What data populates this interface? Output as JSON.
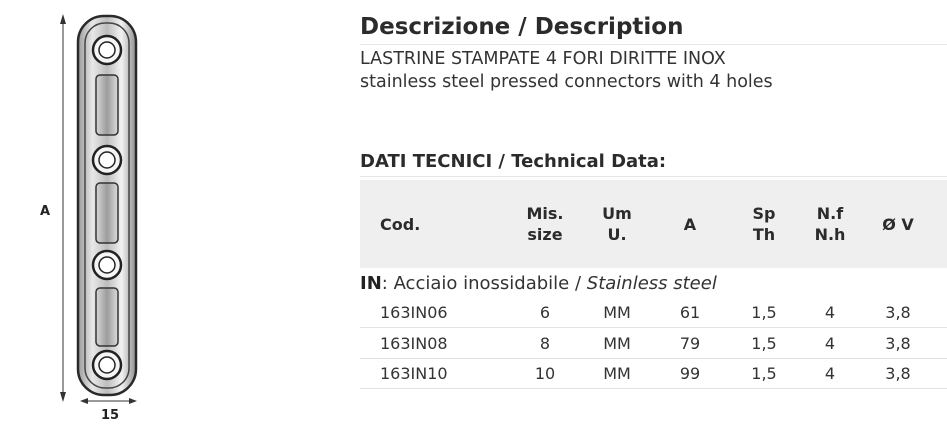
{
  "product_drawing": {
    "dim_a_label": "A",
    "dim_width_label": "15"
  },
  "description": {
    "title": "Descrizione / Description",
    "line_it": "LASTRINE STAMPATE 4 FORI DIRITTE INOX",
    "line_en": "stainless steel pressed connectors with 4 holes"
  },
  "technical": {
    "title": "DATI TECNICI / Technical Data:",
    "headers": [
      {
        "line1": "Cod.",
        "line2": ""
      },
      {
        "line1": "Mis.",
        "line2": "size"
      },
      {
        "line1": "Um",
        "line2": "U."
      },
      {
        "line1": "A",
        "line2": ""
      },
      {
        "line1": "Sp",
        "line2": "Th"
      },
      {
        "line1": "N.f",
        "line2": "N.h"
      },
      {
        "line1": "Ø V",
        "line2": ""
      }
    ],
    "material": {
      "prefix": "IN",
      "separator": ": ",
      "it": "Acciaio inossidabile / ",
      "en": "Stainless steel"
    },
    "rows": [
      [
        "163IN06",
        "6",
        "MM",
        "61",
        "1,5",
        "4",
        "3,8"
      ],
      [
        "163IN08",
        "8",
        "MM",
        "79",
        "1,5",
        "4",
        "3,8"
      ],
      [
        "163IN10",
        "10",
        "MM",
        "99",
        "1,5",
        "4",
        "3,8"
      ]
    ]
  }
}
